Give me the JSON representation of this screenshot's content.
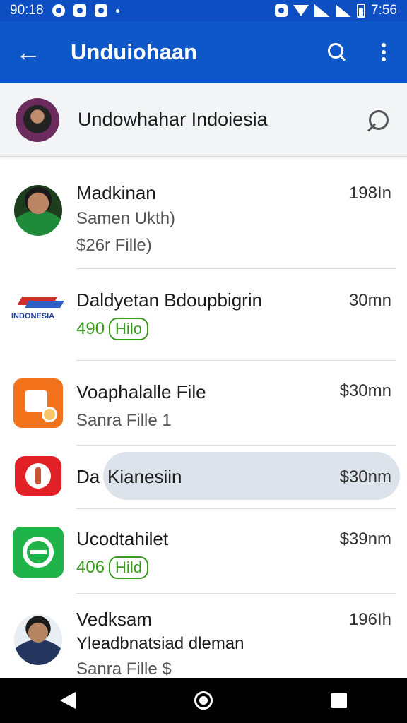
{
  "status_bar": {
    "time_left": "90:18",
    "time_right": "7:56"
  },
  "app_bar": {
    "title": "Unduiohaan"
  },
  "group": {
    "name": "Undowhahar Indoiesia"
  },
  "items": [
    {
      "title": "Madkinan",
      "sub1": "Samen Ukth)",
      "sub2": "$26r Fille)",
      "meta": "198In"
    },
    {
      "title": "Daldyetan Bdoupbigrin",
      "count": "490",
      "chip": "Hilo",
      "meta": "30mn",
      "logo_text": "INDONESIA"
    },
    {
      "title": "Voaphalalle File",
      "sub1": "Sanra Fille 1",
      "meta": "$30mn"
    },
    {
      "title": "Da",
      "title2": "Kianesiin",
      "meta": "$30nm"
    },
    {
      "title": "Ucodtahilet",
      "count": "406",
      "chip": "Hild",
      "meta": "$39nm"
    },
    {
      "title": "Vedksam",
      "sub1": "Yleadbnatsiad dleman",
      "sub2": "Sanra Fille $",
      "meta": "196Ih"
    }
  ],
  "colors": {
    "app_bar": "#0d57c8",
    "tag_green": "#3a9a1e"
  }
}
